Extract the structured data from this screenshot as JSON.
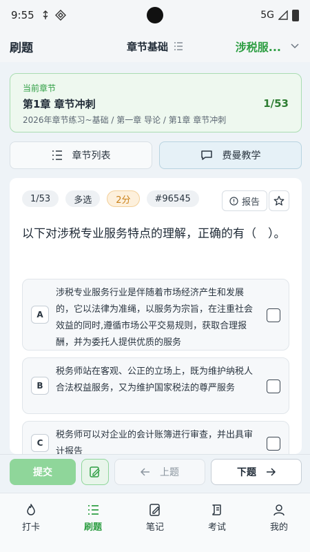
{
  "status": {
    "time": "9:55",
    "network": "5G"
  },
  "header": {
    "title": "刷题",
    "center_title": "章节基础",
    "subject": "涉税服..."
  },
  "chapter": {
    "label": "当前章节",
    "name": "第1章 章节冲刺",
    "path": "2026年章节练习~基础 / 第一章 导论 / 第1章 章节冲刺",
    "progress": "1/53"
  },
  "tabs": [
    {
      "label": "章节列表",
      "icon": "list-icon"
    },
    {
      "label": "费曼教学",
      "icon": "chat-icon"
    }
  ],
  "question": {
    "index": "1/53",
    "type": "多选",
    "score": "2分",
    "id": "#96545",
    "report_label": "报告",
    "text": "以下对涉税专业服务特点的理解，正确的有（　）。",
    "options": [
      {
        "letter": "A",
        "text": "涉税专业服务行业是伴随着市场经济产生和发展的，它以法律为准绳，以服务为宗旨，在注重社会效益的同时,遵循市场公平交易规则，获取合理报酬，并为委托人提供优质的服务"
      },
      {
        "letter": "B",
        "text": "税务师站在客观、公正的立场上，既为维护纳税人合法权益服务，又为维护国家税法的尊严服务"
      },
      {
        "letter": "C",
        "text": "税务师可以对企业的会计账簿进行审查，并出具审计报告"
      }
    ]
  },
  "actions": {
    "submit": "提交",
    "prev": "上题",
    "next": "下题"
  },
  "nav": [
    {
      "label": "打卡",
      "icon": "flame-icon"
    },
    {
      "label": "刷题",
      "icon": "list-icon"
    },
    {
      "label": "笔记",
      "icon": "note-icon"
    },
    {
      "label": "考试",
      "icon": "scroll-icon"
    },
    {
      "label": "我的",
      "icon": "person-icon"
    }
  ]
}
